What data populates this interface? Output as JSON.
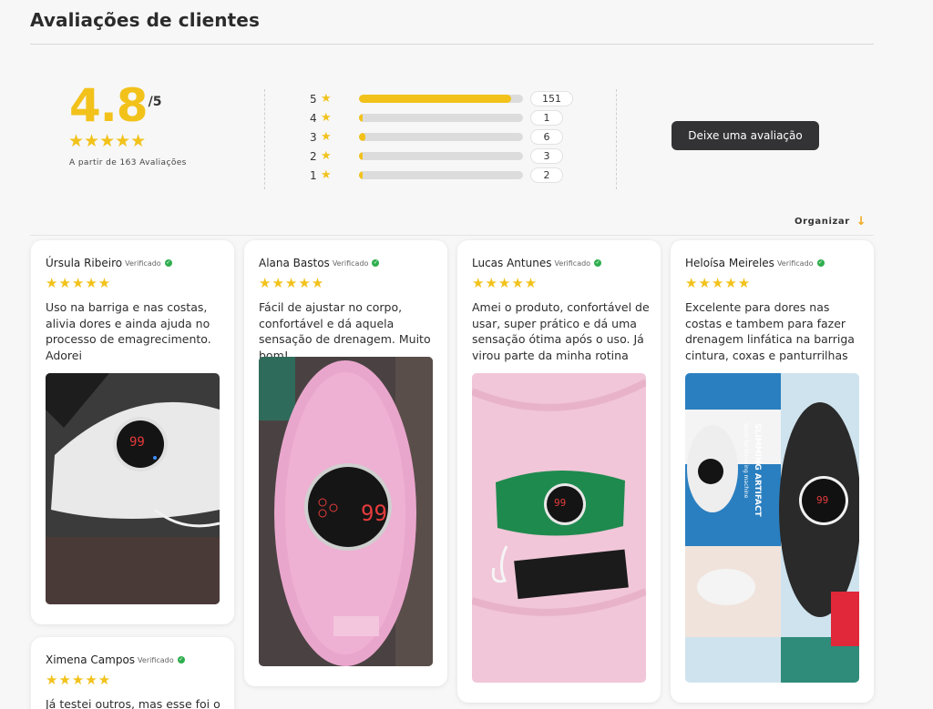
{
  "title": "Avaliações de clientes",
  "summary": {
    "score": "4.8",
    "score_max": "/5",
    "stars": "★★★★★",
    "based_on": "A partir de 163 Avaliações"
  },
  "distribution": [
    {
      "rating": "5",
      "count": "151",
      "fraction": 0.9264
    },
    {
      "rating": "4",
      "count": "1",
      "fraction": 0.0061
    },
    {
      "rating": "3",
      "count": "6",
      "fraction": 0.0368
    },
    {
      "rating": "2",
      "count": "3",
      "fraction": 0.0184
    },
    {
      "rating": "1",
      "count": "2",
      "fraction": 0.0123
    }
  ],
  "actions": {
    "write_review": "Deixe uma avaliação",
    "sort_label": "Organizar"
  },
  "icons": {
    "star": "star-icon",
    "verified": "verified-check-icon",
    "sort": "arrow-down-icon"
  },
  "colors": {
    "accent": "#f2c21b",
    "verified": "#2fae4e",
    "button": "#333335"
  },
  "reviews": [
    {
      "name": "Úrsula Ribeiro",
      "verified": "Verificado",
      "stars": "★★★★★",
      "text": "Uso na barriga e nas costas, alivia dores e ainda ajuda no processo de emagrecimento. Adorei",
      "image": "white-massager-photo"
    },
    {
      "name": "Alana Bastos",
      "verified": "Verificado",
      "stars": "★★★★★",
      "text": "Fácil de ajustar no corpo, confortável e dá aquela sensação de drenagem. Muito bom!",
      "image": "pink-massager-photo"
    },
    {
      "name": "Lucas Antunes",
      "verified": "Verificado",
      "stars": "★★★★★",
      "text": "Amei o produto, confortável de usar, super prático e dá uma sensação ótima após o uso. Já virou parte da minha rotina",
      "image": "green-massager-photo"
    },
    {
      "name": "Heloísa Meireles",
      "verified": "Verificado",
      "stars": "★★★★★",
      "text": "Excelente para dores nas costas e tambem para fazer drenagem linfática na barriga cintura, coxas e panturrilhas",
      "image": "black-massager-box-photo",
      "box_text": "SLIMMING ARTIFACT",
      "box_subtext": "Waist fat throwing machine"
    },
    {
      "name": "Ximena Campos",
      "verified": "Verificado",
      "stars": "★★★★★",
      "text": "Já testei outros, mas esse foi o"
    }
  ]
}
